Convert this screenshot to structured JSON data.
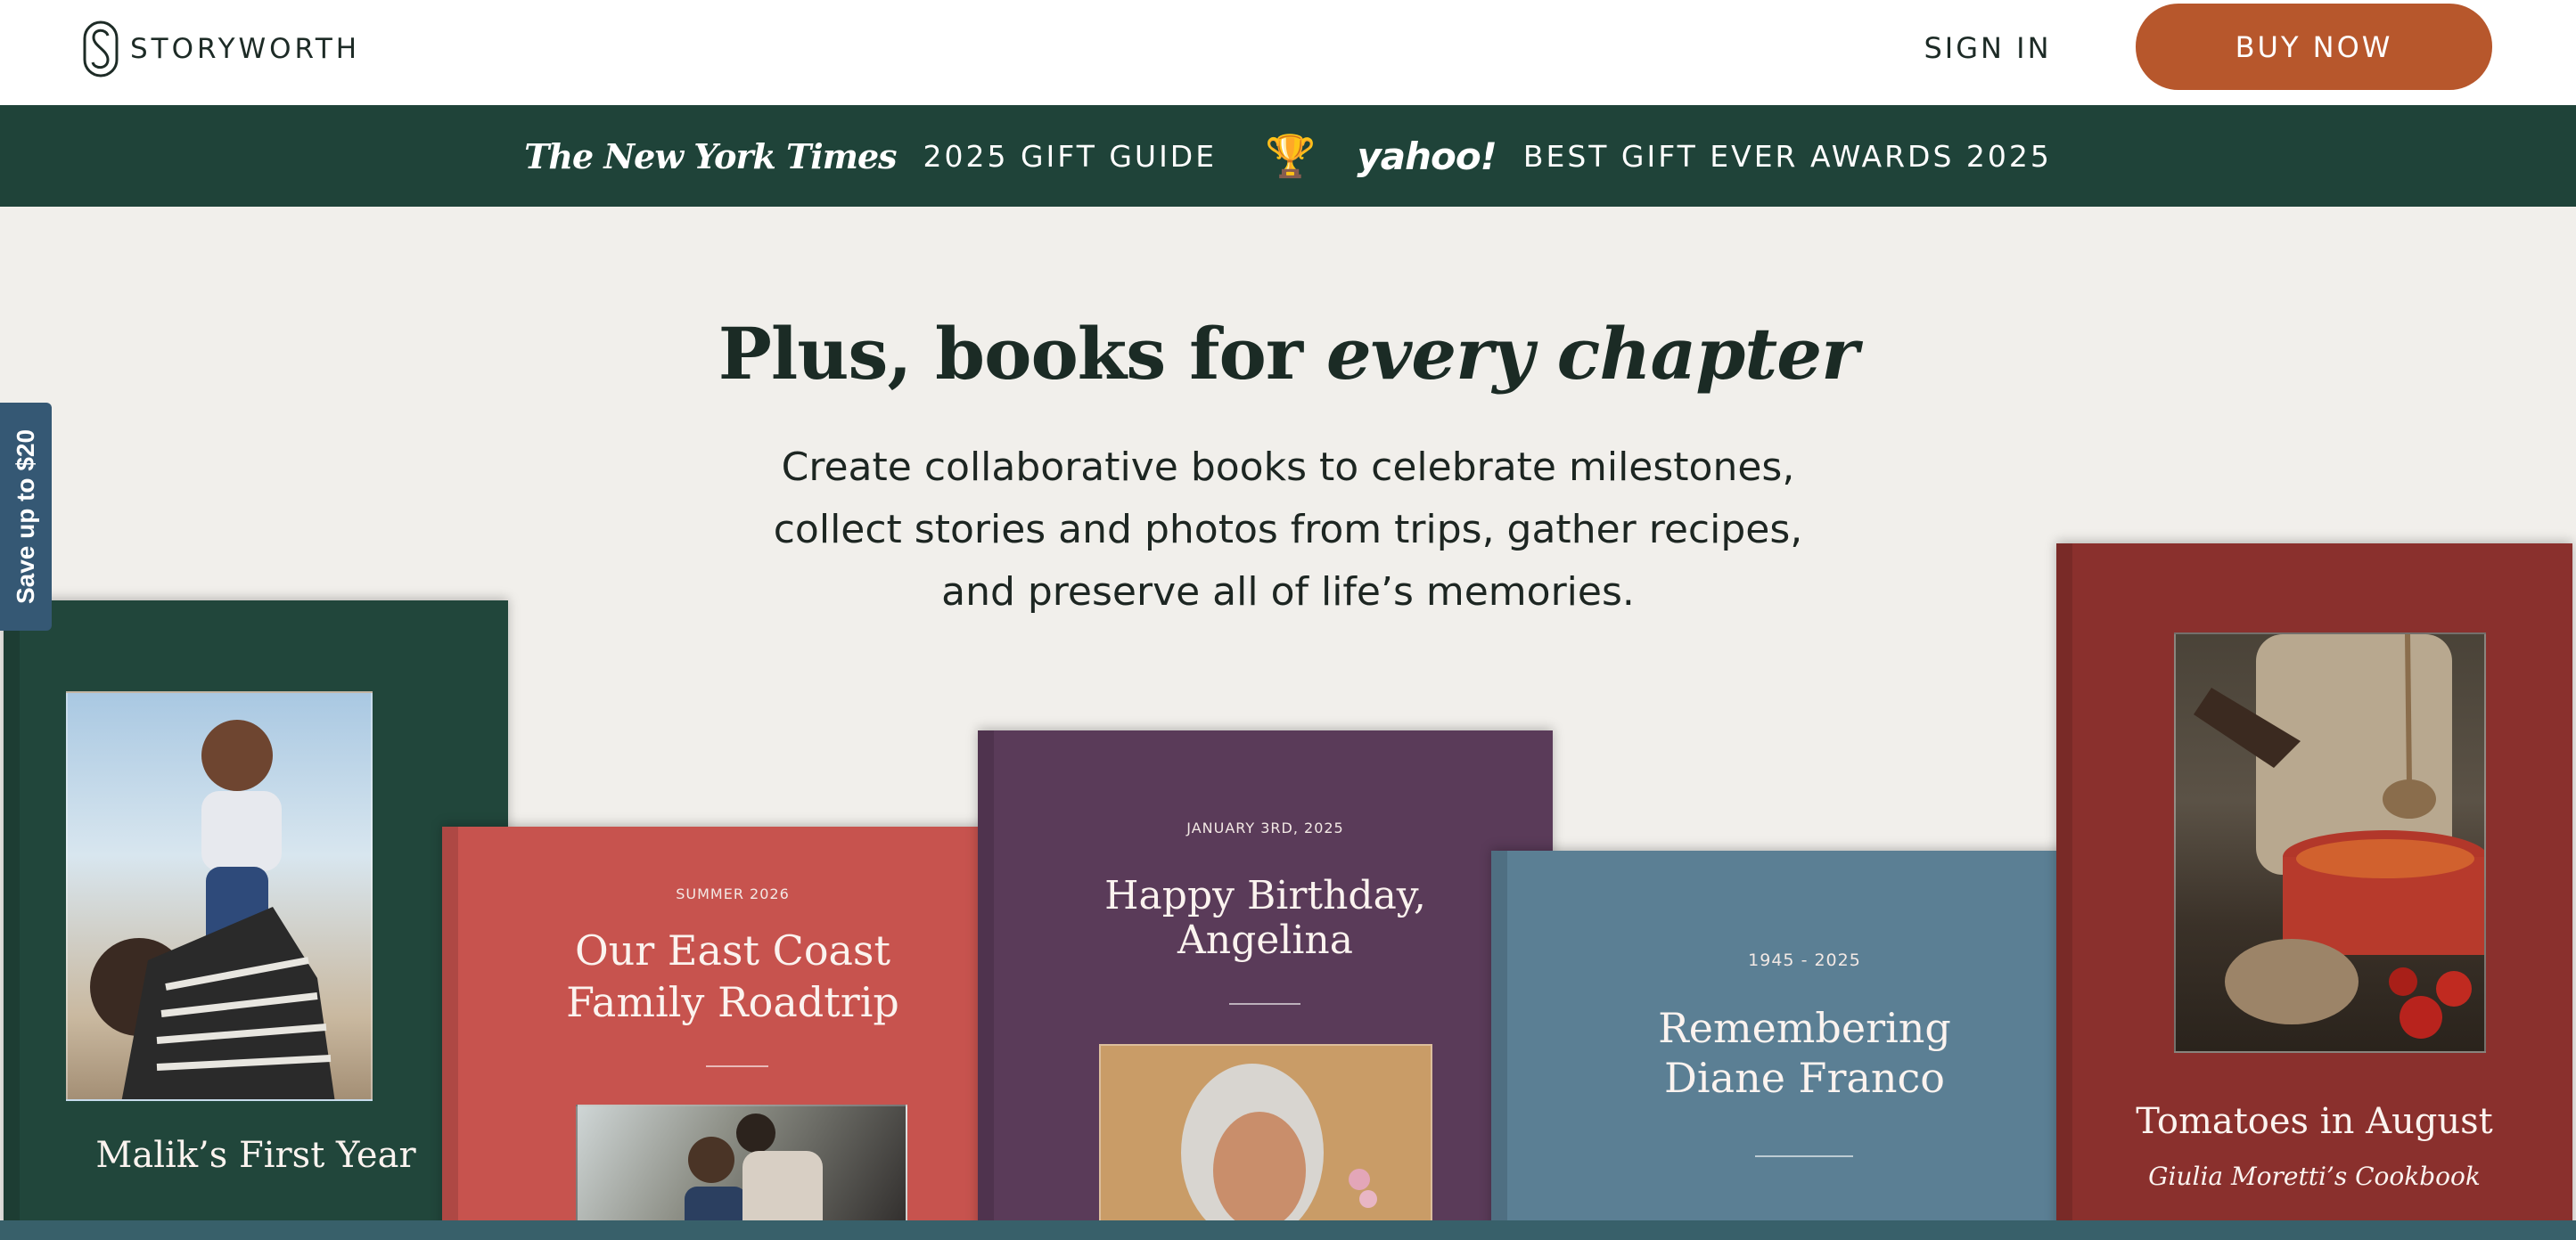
{
  "header": {
    "logo_text": "STORYWORTH",
    "sign_in": "SIGN IN",
    "buy_now": "BUY NOW"
  },
  "awards_bar": {
    "nyt_logo_text": "The New York Times",
    "nyt_award": "2025 GIFT GUIDE",
    "trophy_icon": "trophy-icon",
    "yahoo_logo_text": "yahoo!",
    "yahoo_award": "BEST GIFT EVER AWARDS 2025"
  },
  "hero": {
    "headline_regular": "Plus, books for ",
    "headline_italic": "every chapter",
    "subcopy": "Create collaborative books to celebrate milestones, collect stories and photos from trips, gather recipes, and preserve all of life’s memories."
  },
  "save_tab": "Save up to $20",
  "books": {
    "malik": {
      "title": "Malik’s First Year"
    },
    "roadtrip": {
      "date": "SUMMER 2026",
      "title_line1": "Our East Coast",
      "title_line2": "Family Roadtrip"
    },
    "birthday": {
      "date": "JANUARY 3RD, 2025",
      "title_line1": "Happy Birthday,",
      "title_line2": "Angelina"
    },
    "diane": {
      "years": "1945 - 2025",
      "title_line1": "Remembering",
      "title_line2": "Diane Franco"
    },
    "tomatoes": {
      "title": "Tomatoes in August",
      "subtitle": "Giulia Moretti’s Cookbook"
    }
  },
  "colors": {
    "brand_orange": "#b7572c",
    "awards_green": "#1f4339",
    "save_tab_blue": "#355874"
  }
}
